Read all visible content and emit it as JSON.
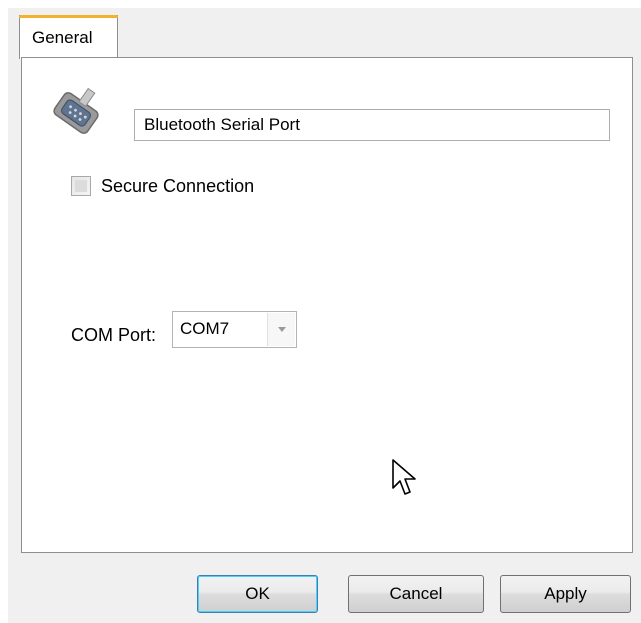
{
  "tabs": [
    {
      "label": "General",
      "active": true
    }
  ],
  "general": {
    "icon": "serial-port-icon",
    "name_value": "Bluetooth Serial Port",
    "secure_connection_label": "Secure Connection",
    "secure_connection_checked": false,
    "com_port_label": "COM Port:",
    "com_port_value": "COM7"
  },
  "buttons": {
    "ok": "OK",
    "cancel": "Cancel",
    "apply": "Apply"
  },
  "colors": {
    "tab_accent": "#f3b132",
    "ok_focus_border": "#3c7fb1"
  }
}
